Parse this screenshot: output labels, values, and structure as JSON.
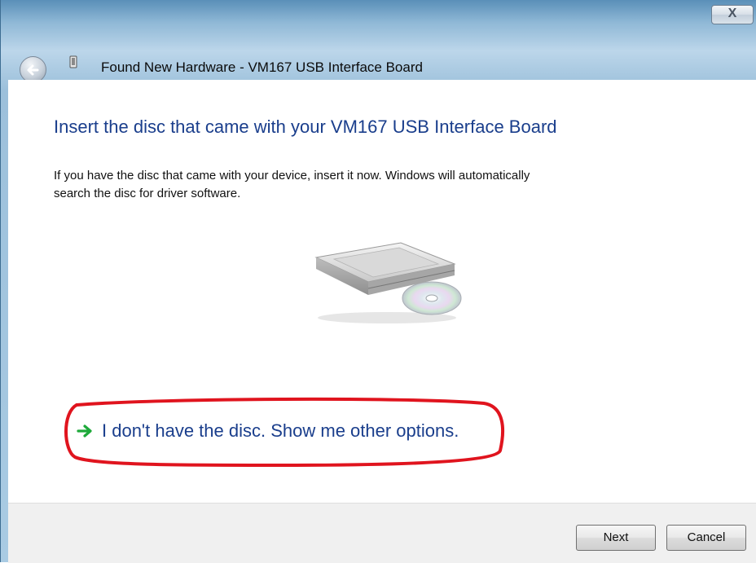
{
  "window": {
    "title": "Found New Hardware - VM167 USB Interface Board",
    "close_label": "X"
  },
  "content": {
    "heading": "Insert the disc that came with your VM167 USB Interface Board",
    "description_line1": "If you have the disc that came with your device, insert it now.  Windows will automatically",
    "description_line2": "search the disc for driver software.",
    "option_link": "I don't have the disc.  Show me other options."
  },
  "footer": {
    "next_label": "Next",
    "cancel_label": "Cancel"
  },
  "colors": {
    "heading_blue": "#1a3e8c",
    "annotation_red": "#e0141e",
    "arrow_green": "#1ea93a"
  },
  "icons": [
    "close-icon",
    "back-arrow-icon",
    "usb-device-icon",
    "disc-drive-icon",
    "green-arrow-icon"
  ]
}
